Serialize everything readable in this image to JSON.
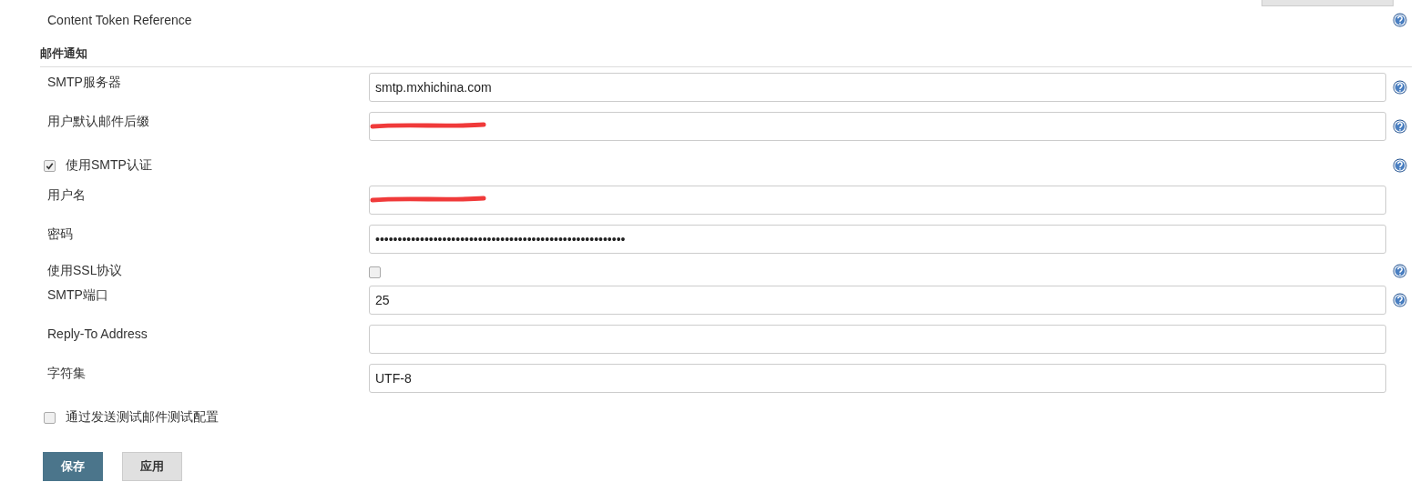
{
  "top_row": {
    "label": "Content Token Reference",
    "help": true
  },
  "section": {
    "title": "邮件通知"
  },
  "rows": [
    {
      "kind": "field",
      "label": "SMTP服务器",
      "value": "smtp.mxhichina.com",
      "redacted": false,
      "help": true
    },
    {
      "kind": "field",
      "label": "用户默认邮件后缀",
      "redacted": true,
      "help": true
    },
    {
      "kind": "checkbox",
      "label": "使用SMTP认证",
      "checked": true,
      "help": true
    },
    {
      "kind": "field",
      "label": "用户名",
      "redacted": true,
      "help": false
    },
    {
      "kind": "field",
      "label": "密码",
      "value": "••••••••••••••••••••••••••••••••••••••••••••••••••••••••",
      "redacted": false,
      "help": false
    },
    {
      "kind": "inline-checkbox",
      "label": "使用SSL协议",
      "checked": false,
      "help": true
    },
    {
      "kind": "field",
      "label": "SMTP端口",
      "value": "25",
      "redacted": false,
      "help": true
    },
    {
      "kind": "field",
      "label": "Reply-To Address",
      "redacted": false,
      "help": false
    },
    {
      "kind": "field",
      "label": "字符集",
      "value": "UTF-8",
      "redacted": false,
      "help": false
    },
    {
      "kind": "checkbox",
      "label": "通过发送测试邮件测试配置",
      "checked": false,
      "help": false
    }
  ],
  "buttons": [
    {
      "label": "保存",
      "primary": true
    },
    {
      "label": "应用",
      "primary": false
    }
  ]
}
